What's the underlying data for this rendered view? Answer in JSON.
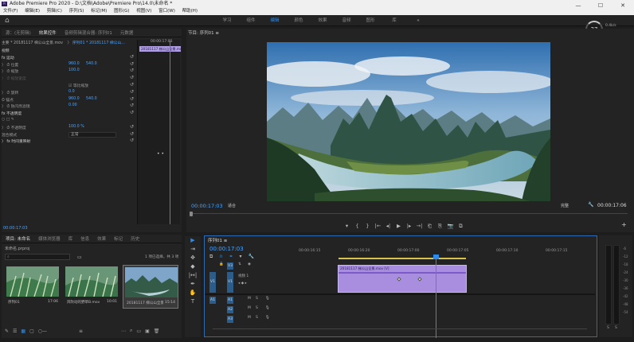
{
  "window": {
    "title": "Adobe Premiere Pro 2020 - D:\\文档\\Adobe\\Premiere Pro\\14.0\\未命名 *",
    "controls": [
      "—",
      "☐",
      "✕"
    ]
  },
  "menu": [
    "文件(F)",
    "编辑(E)",
    "剪辑(C)",
    "序列(S)",
    "标记(M)",
    "图形(G)",
    "视图(V)",
    "窗口(W)",
    "帮助(H)"
  ],
  "workspaces": {
    "tabs": [
      "学习",
      "组件",
      "编辑",
      "颜色",
      "效果",
      "音频",
      "图形",
      "库"
    ],
    "active_index": 2,
    "more": "»"
  },
  "perf": {
    "percent": "37",
    "line1": "0.4k/s",
    "line2": "0.3k/s"
  },
  "effect_controls": {
    "tabs": [
      "源：(无剪辑)",
      "效果控件",
      "音频剪辑混合器: 序列01",
      "元数据"
    ],
    "active_index": 1,
    "header_master": "主要 * 20181117 梯公山全景.mov",
    "header_seq": "序列01 * 20181117 梯公山...",
    "section_video": "视频",
    "rows": [
      {
        "label": "fx 运动",
        "type": "section"
      },
      {
        "label": "〉 ⏱ 位置",
        "v1": "960.0",
        "v2": "540.0"
      },
      {
        "label": "〉 ⏱ 缩放",
        "v1": "100.0"
      },
      {
        "label": "〉 ⏱ 缩放宽度",
        "v1": "",
        "dim": true
      },
      {
        "label": "",
        "checkbox": "等比缩放"
      },
      {
        "label": "〉 ⏱ 旋转",
        "v1": "0.0"
      },
      {
        "label": "  ⏱ 锚点",
        "v1": "960.0",
        "v2": "540.0"
      },
      {
        "label": "〉 ⏱ 防闪烁滤镜",
        "v1": "0.00"
      },
      {
        "label": "fx 不透明度",
        "type": "section"
      },
      {
        "label": "  ○ □ ✎",
        "type": "shapes"
      },
      {
        "label": "〉 ⏱ 不透明度",
        "v1": "100.0 %"
      },
      {
        "label": "  混合模式",
        "select": "正常"
      },
      {
        "label": "〉 fx 时间重映射",
        "type": "section"
      }
    ],
    "mini_ruler": "00:00:17:03",
    "mini_clip": "20181117 梯公山全景.mov",
    "timecode": "00:00:17:03"
  },
  "program": {
    "title": "节目: 序列01 ≡",
    "timecode_left": "00:00:17:03",
    "fit": "适合",
    "quality": "完整",
    "timecode_right": "00:00:17:06",
    "transport": [
      "▾",
      "{",
      "}",
      "|←",
      "◂|",
      "▶",
      "|▸",
      "→|",
      "⎗",
      "⎘",
      "📷",
      "⧉"
    ],
    "add_button": "+"
  },
  "project": {
    "tabs": [
      "项目: 未命名",
      "媒体浏览器",
      "库",
      "信息",
      "效果",
      "标记",
      "历史"
    ],
    "active_index": 0,
    "bin": "未命名.prproj",
    "search_placeholder": "",
    "selection_info": "1 项已选择，共 3 项",
    "items": [
      {
        "name": "序列01",
        "duration": "17:06"
      },
      {
        "name": "风吹动的野草B.mov",
        "duration": "10:01"
      },
      {
        "name": "20181117 梯公山全景",
        "duration": "15:14"
      }
    ]
  },
  "tools": [
    "▶",
    "⇥",
    "✥",
    "◆",
    "|↔|",
    "✒",
    "✋",
    "T"
  ],
  "timeline": {
    "tab": "序列01 ≡",
    "timecode": "00:00:17:03",
    "ruler": [
      "00:00:16:15",
      "00:00:16:20",
      "00:00:17:00",
      "00:00:17:05",
      "00:00:17:10",
      "00:00:17:15"
    ],
    "video_tracks": [
      {
        "src": "",
        "name": "V3"
      },
      {
        "src": "V1",
        "name": "V1",
        "label": "视频 1"
      }
    ],
    "audio_tracks": [
      {
        "src": "A1",
        "name": "A1",
        "m": "M",
        "s": "S"
      },
      {
        "src": "",
        "name": "A2",
        "m": "M",
        "s": "S"
      },
      {
        "src": "",
        "name": "A3",
        "m": "M",
        "s": "S"
      }
    ],
    "clip_label": "20181117 梯公山全景.mov [V]"
  },
  "meters": {
    "scale": [
      "-6",
      "-12",
      "-18",
      "-24",
      "-30",
      "-36",
      "-42",
      "-48",
      "-54"
    ],
    "labels": [
      "S",
      "S"
    ]
  }
}
